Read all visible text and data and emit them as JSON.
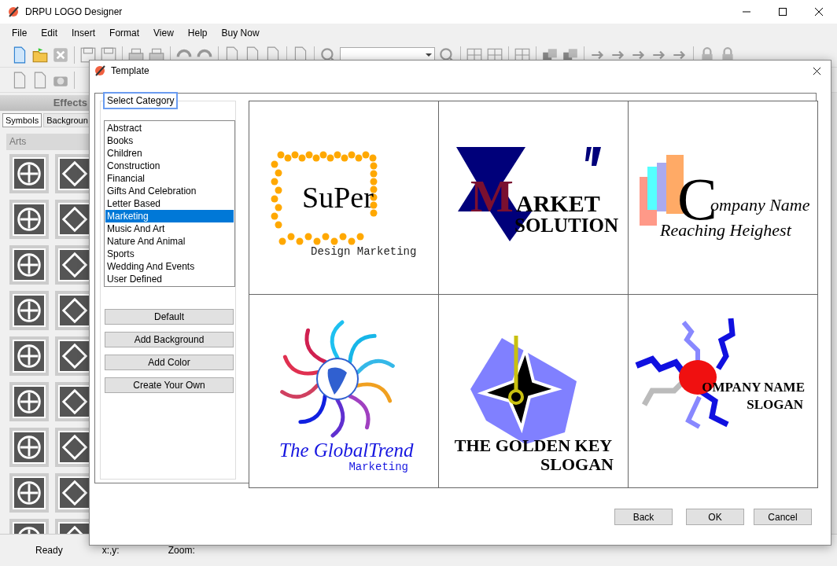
{
  "window": {
    "title": "DRPU LOGO Designer"
  },
  "menu": [
    "File",
    "Edit",
    "Insert",
    "Format",
    "View",
    "Help",
    "Buy Now"
  ],
  "effects_panel": {
    "title": "Effects",
    "tabs": [
      {
        "label": "Symbols",
        "selected": true
      },
      {
        "label": "Backgroun",
        "selected": false
      }
    ],
    "section": "Arts"
  },
  "status_bar": [
    "Ready",
    "x:,y:",
    "Zoom:"
  ],
  "dialog": {
    "title": "Template",
    "group_label": "Select Category",
    "categories": [
      {
        "label": "Abstract",
        "selected": false
      },
      {
        "label": "Books",
        "selected": false
      },
      {
        "label": "Children",
        "selected": false
      },
      {
        "label": "Construction",
        "selected": false
      },
      {
        "label": "Financial",
        "selected": false
      },
      {
        "label": "Gifts And Celebration",
        "selected": false
      },
      {
        "label": "Letter Based",
        "selected": false
      },
      {
        "label": "Marketing",
        "selected": true
      },
      {
        "label": "Music And Art",
        "selected": false
      },
      {
        "label": "Nature And Animal",
        "selected": false
      },
      {
        "label": "Sports",
        "selected": false
      },
      {
        "label": "Wedding And Events",
        "selected": false
      },
      {
        "label": "User Defined",
        "selected": false
      }
    ],
    "side_buttons": [
      "Default",
      "Add Background",
      "Add Color",
      "Create Your Own"
    ],
    "templates": [
      {
        "kind": "dots",
        "lines": [
          "SuPer",
          "Design Marketing"
        ]
      },
      {
        "kind": "triangles",
        "lines": [
          "M",
          "ARKET",
          "SOLUTION"
        ]
      },
      {
        "kind": "rectangles",
        "lines": [
          "C",
          "ompany Name",
          "Reaching Heighest"
        ]
      },
      {
        "kind": "globe",
        "lines": [
          "The GlobalTrend",
          "Marketing"
        ]
      },
      {
        "kind": "star",
        "lines": [
          "THE GOLDEN KEY",
          "SLOGAN"
        ]
      },
      {
        "kind": "zigzag",
        "lines": [
          "OMPANY NAME",
          "SLOGAN"
        ]
      }
    ],
    "buttons": [
      "Back",
      "OK",
      "Cancel"
    ]
  }
}
